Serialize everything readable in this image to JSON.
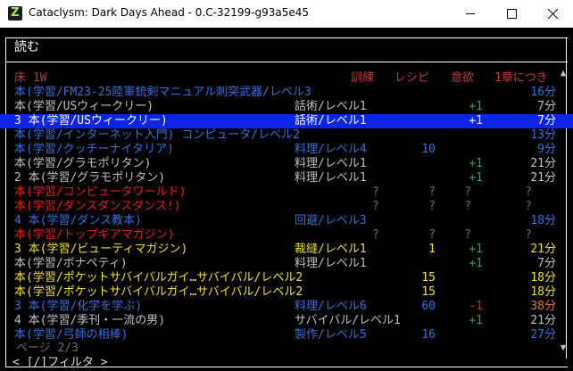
{
  "window": {
    "icon_letter": "Z",
    "title": "Cataclysm: Dark Days Ahead - 0.C-32199-g93a5e45"
  },
  "screen": {
    "title": "読む",
    "header": {
      "location": "床 1W",
      "training": "訓練",
      "recipes": "レシピ",
      "fun": "意欲",
      "time": "1章につき",
      "color": "#c23c3c"
    },
    "rows": [
      {
        "name": "本(学習/FM23-25陸軍銃剣マニュアル刺突武器/レベル3",
        "skill": "",
        "recipes": "",
        "fun": "",
        "time": "16分",
        "color": "#3a6fd8",
        "skill_color": "#3a6fd8",
        "fun_color": "#3a6fd8",
        "time_color": "#3a6fd8"
      },
      {
        "name": "本(学習/USウィークリー)",
        "skill": "話術/レベル1",
        "recipes": "",
        "fun": "+1",
        "time": "7分",
        "color": "#c0c0c0",
        "skill_color": "#c0c0c0",
        "fun_color": "#3aa83a",
        "time_color": "#c0c0c0"
      },
      {
        "name": "3 本(学習/USウィークリー)",
        "skill": "話術/レベル1",
        "recipes": "",
        "fun": "+1",
        "time": "7分",
        "color": "#ffffff",
        "skill_color": "#ffffff",
        "fun_color": "#ffffff",
        "time_color": "#ffffff",
        "selected": true
      },
      {
        "name": "本(学習/インターネット入門) コンピュータ/レベル2",
        "skill": "",
        "recipes": "",
        "fun": "",
        "time": "13分",
        "color": "#3a6fd8",
        "skill_color": "#3a6fd8",
        "fun_color": "#3a6fd8",
        "time_color": "#3a6fd8"
      },
      {
        "name": "本(学習/クッチーナイタリア)",
        "skill": "料理/レベル4",
        "recipes": "10",
        "fun": "",
        "time": "9分",
        "color": "#3a6fd8",
        "skill_color": "#3a6fd8",
        "fun_color": "#3a6fd8",
        "time_color": "#3a6fd8"
      },
      {
        "name": "本(学習/グラモポリタン)",
        "skill": "料理/レベル1",
        "recipes": "",
        "fun": "+1",
        "time": "21分",
        "color": "#c0c0c0",
        "skill_color": "#c0c0c0",
        "fun_color": "#3aa83a",
        "time_color": "#c0c0c0"
      },
      {
        "name": "2 本(学習/グラモポリタン)",
        "skill": "料理/レベル1",
        "recipes": "",
        "fun": "+1",
        "time": "21分",
        "color": "#c0c0c0",
        "skill_color": "#c0c0c0",
        "fun_color": "#3aa83a",
        "time_color": "#c0c0c0"
      },
      {
        "name": "本(学習/コンピュータワールド)",
        "skill": "?",
        "recipes": "?",
        "fun": "?",
        "time": "?",
        "color": "#e02020",
        "skill_color": "#6b6b6b",
        "fun_color": "#6b6b6b",
        "time_color": "#6b6b6b"
      },
      {
        "name": "本(学習/ダンスダンスダンス!)",
        "skill": "?",
        "recipes": "?",
        "fun": "?",
        "time": "?",
        "color": "#e02020",
        "skill_color": "#6b6b6b",
        "fun_color": "#6b6b6b",
        "time_color": "#6b6b6b"
      },
      {
        "name": "4 本(学習/ダンス教本)",
        "skill": "回避/レベル3",
        "recipes": "",
        "fun": "",
        "time": "18分",
        "color": "#3a6fd8",
        "skill_color": "#3a6fd8",
        "fun_color": "#3a6fd8",
        "time_color": "#3a6fd8"
      },
      {
        "name": "本(学習/トップギアマガジン)",
        "skill": "?",
        "recipes": "?",
        "fun": "?",
        "time": "?",
        "color": "#e02020",
        "skill_color": "#6b6b6b",
        "fun_color": "#6b6b6b",
        "time_color": "#6b6b6b"
      },
      {
        "name": "3 本(学習/ビューティマガジン)",
        "skill": "裁縫/レベル1",
        "recipes": "1",
        "fun": "+1",
        "time": "21分",
        "color": "#f0e030",
        "skill_color": "#f0e030",
        "fun_color": "#3aa83a",
        "time_color": "#f0e030"
      },
      {
        "name": "本(学習/ボナペティ)",
        "skill": "料理/レベル1",
        "recipes": "",
        "fun": "+1",
        "time": "7分",
        "color": "#c0c0c0",
        "skill_color": "#c0c0c0",
        "fun_color": "#3aa83a",
        "time_color": "#c0c0c0"
      },
      {
        "name": "本(学習/ポケットサバイバルガイ…サバイバル/レベル2",
        "skill": "",
        "recipes": "15",
        "fun": "",
        "time": "18分",
        "color": "#f0e030",
        "skill_color": "#f0e030",
        "fun_color": "#f0e030",
        "time_color": "#f0e030"
      },
      {
        "name": "本(学習/ポケットサバイバルガイ…サバイバル/レベル2",
        "skill": "",
        "recipes": "15",
        "fun": "",
        "time": "18分",
        "color": "#f0e030",
        "skill_color": "#f0e030",
        "fun_color": "#f0e030",
        "time_color": "#f0e030"
      },
      {
        "name": "3 本(学習/化学を学ぶ)",
        "skill": "料理/レベル6",
        "recipes": "60",
        "fun": "-1",
        "time": "38分",
        "color": "#3a6fd8",
        "skill_color": "#3a6fd8",
        "fun_color": "#e02020",
        "time_color": "#e07a20"
      },
      {
        "name": "4 本(学習/季刊・一流の男)",
        "skill": "サバイバル/レベル1",
        "recipes": "",
        "fun": "+1",
        "time": "21分",
        "color": "#c0c0c0",
        "skill_color": "#c0c0c0",
        "fun_color": "#3aa83a",
        "time_color": "#c0c0c0"
      },
      {
        "name": "本(学習/弓師の相棒)",
        "skill": "製作/レベル5",
        "recipes": "16",
        "fun": "",
        "time": "27分",
        "color": "#3a6fd8",
        "skill_color": "#3a6fd8",
        "fun_color": "#3a6fd8",
        "time_color": "#3a6fd8"
      }
    ],
    "page": "ページ 2/3",
    "filter": "< [/]フィルタ >"
  }
}
